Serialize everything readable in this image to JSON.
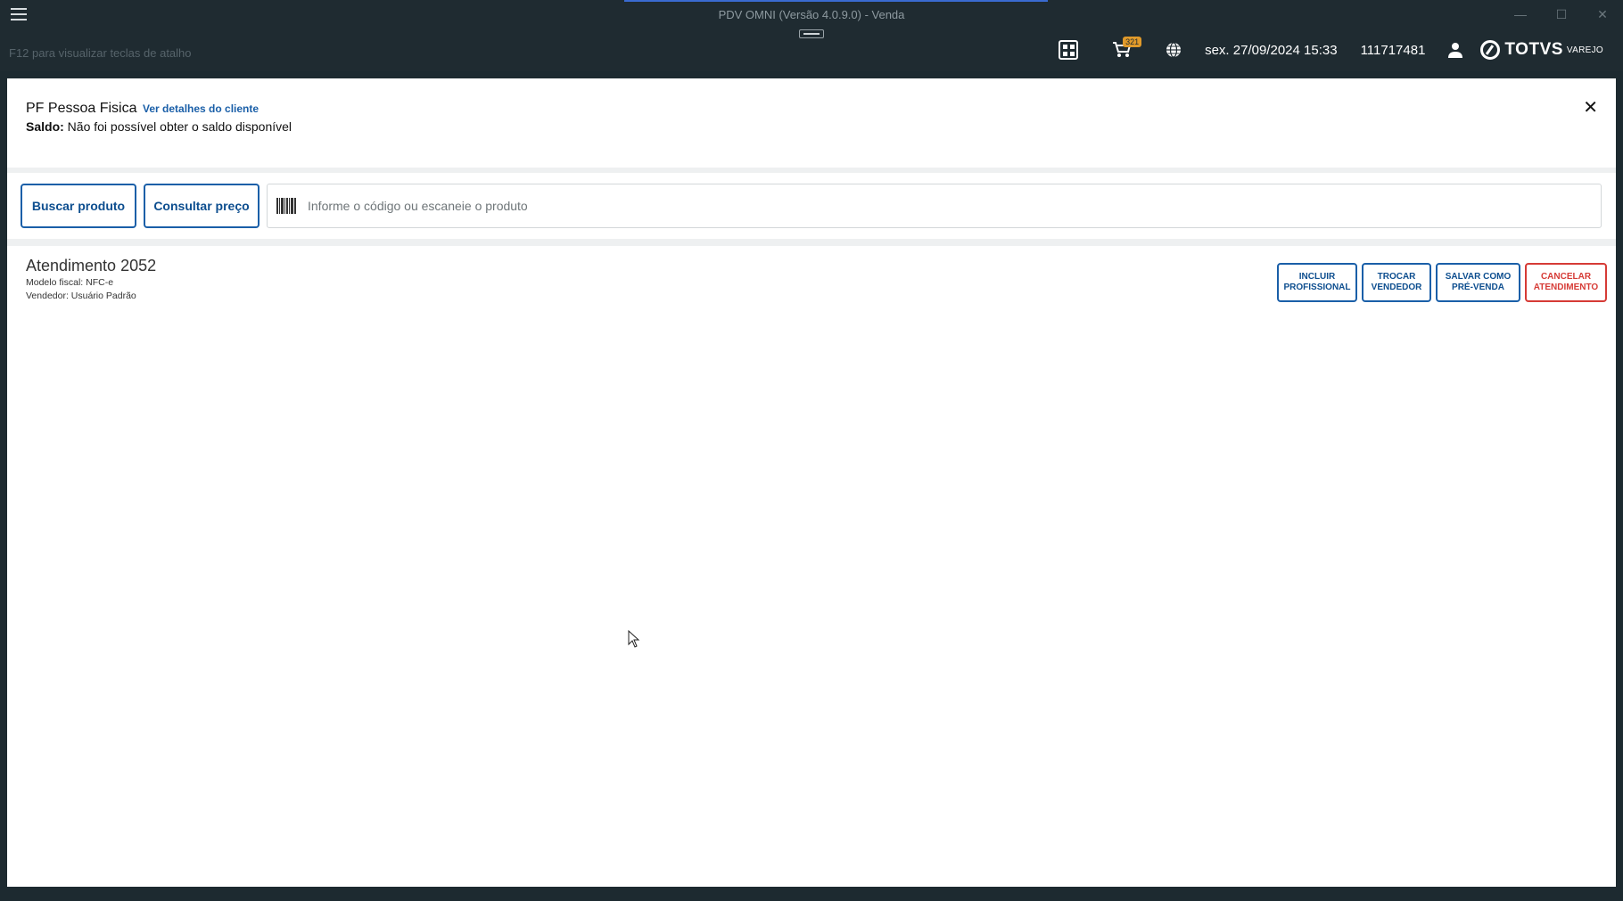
{
  "window": {
    "title": "PDV OMNI (Versão 4.0.9.0) - Venda",
    "minimize_glyph": "—",
    "maximize_glyph": "☐",
    "close_glyph": "✕"
  },
  "header": {
    "shortcut_hint": "F12 para visualizar teclas de atalho",
    "cart_badge": "321",
    "datetime": "sex. 27/09/2024 15:33",
    "terminal_id": "111717481",
    "brand_name": "TOTVS",
    "brand_sub": "VAREJO",
    "icons": [
      "menu-icon",
      "qr-code-icon",
      "cart-icon",
      "globe-icon",
      "user-icon",
      "totvs-logo"
    ]
  },
  "client": {
    "name": "PF Pessoa Fisica",
    "details_link": "Ver detalhes do cliente",
    "saldo_label": "Saldo:",
    "saldo_value": "Não foi possível obter o saldo disponível",
    "close_glyph": "✕"
  },
  "search": {
    "buscar_label": "Buscar produto",
    "consultar_label": "Consultar preço",
    "input_placeholder": "Informe o código ou escaneie o produto",
    "input_value": ""
  },
  "attendance": {
    "title": "Atendimento 2052",
    "fiscal_model": "Modelo fiscal: NFC-e",
    "seller": "Vendedor: Usuário Padrão",
    "buttons": {
      "incluir": "INCLUIR\nPROFISSIONAL",
      "trocar": "TROCAR\nVENDEDOR",
      "salvar": "SALVAR COMO\nPRÉ-VENDA",
      "cancelar": "CANCELAR\nATENDIMENTO"
    }
  },
  "colors": {
    "titlebar": "#1f2b31",
    "primary": "#1a5fa8",
    "danger": "#d63b36",
    "badge": "#e09a2a"
  }
}
